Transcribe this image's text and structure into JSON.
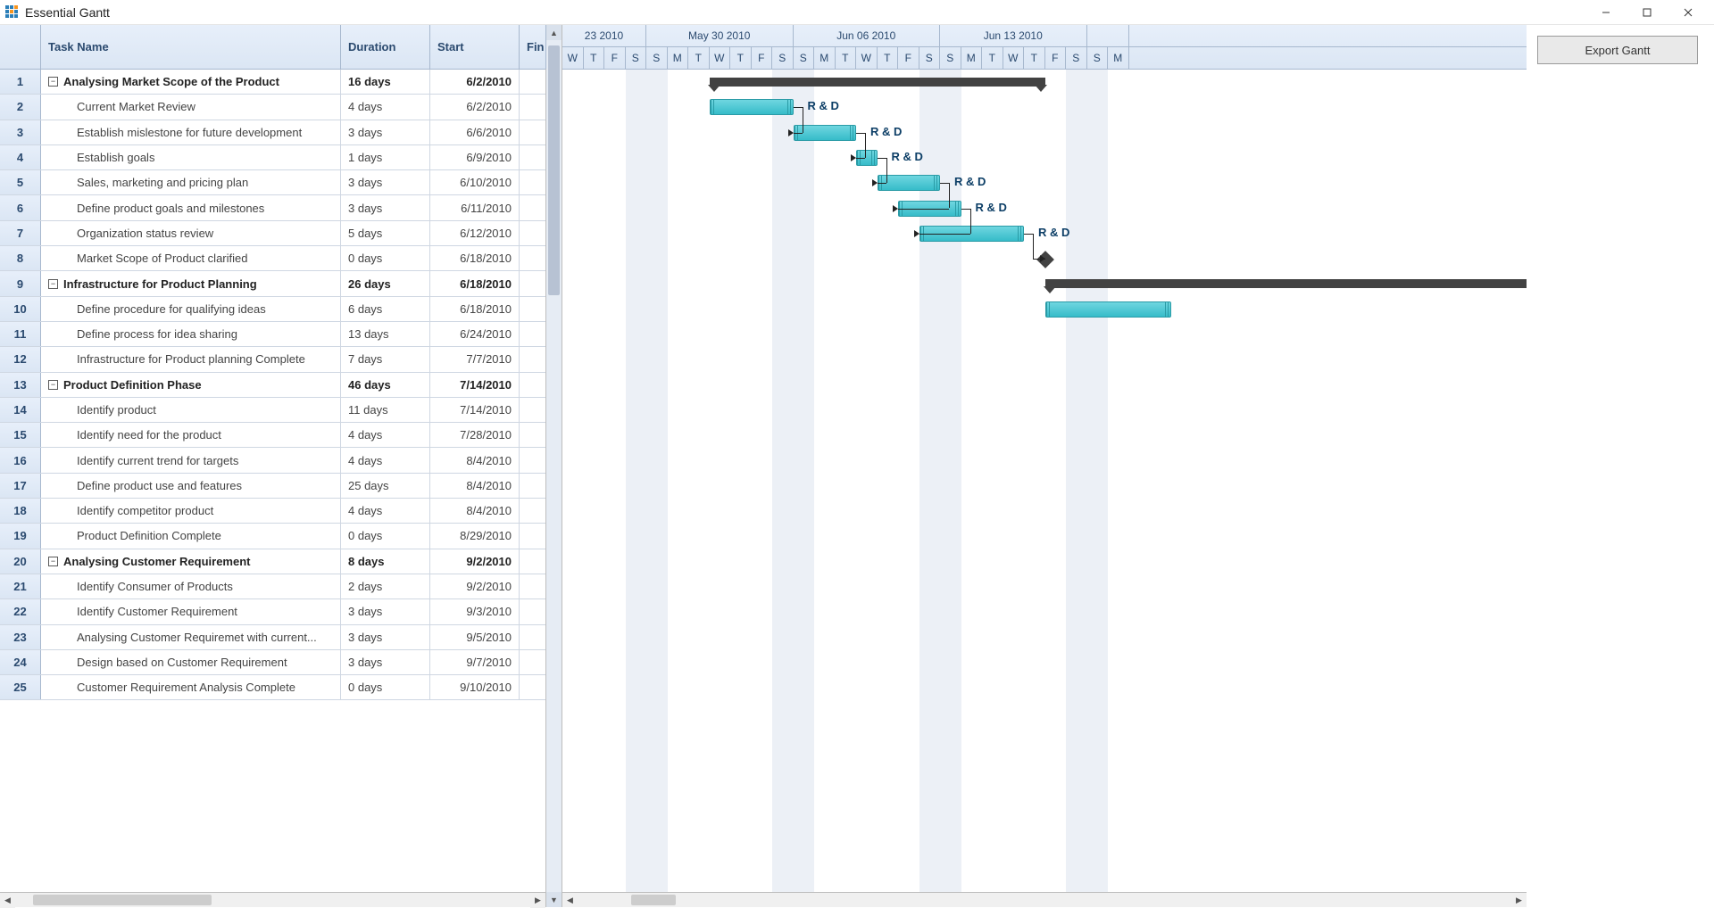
{
  "app": {
    "title": "Essential Gantt"
  },
  "columns": {
    "task": "Task Name",
    "duration": "Duration",
    "start": "Start",
    "finish": "Fin"
  },
  "export_label": "Export Gantt",
  "timescale": {
    "weeks": [
      {
        "label": "23 2010",
        "days": 4
      },
      {
        "label": "May 30 2010",
        "days": 7
      },
      {
        "label": "Jun 06 2010",
        "days": 7
      },
      {
        "label": "Jun 13 2010",
        "days": 7
      },
      {
        "label": "",
        "days": 2
      }
    ],
    "days": [
      "W",
      "T",
      "F",
      "S",
      "S",
      "M",
      "T",
      "W",
      "T",
      "F",
      "S",
      "S",
      "M",
      "T",
      "W",
      "T",
      "F",
      "S",
      "S",
      "M",
      "T",
      "W",
      "T",
      "F",
      "S",
      "S",
      "M"
    ]
  },
  "tasks": [
    {
      "num": 1,
      "type": "summary",
      "name": "Analysing Market Scope of the Product",
      "duration": "16 days",
      "start": "6/2/2010"
    },
    {
      "num": 2,
      "type": "task",
      "name": "Current Market Review",
      "duration": "4 days",
      "start": "6/2/2010",
      "res": "R & D"
    },
    {
      "num": 3,
      "type": "task",
      "name": "Establish mislestone for future development",
      "duration": "3 days",
      "start": "6/6/2010",
      "res": "R & D"
    },
    {
      "num": 4,
      "type": "task",
      "name": "Establish goals",
      "duration": "1 days",
      "start": "6/9/2010",
      "res": "R & D"
    },
    {
      "num": 5,
      "type": "task",
      "name": "Sales, marketing and pricing plan",
      "duration": "3 days",
      "start": "6/10/2010",
      "res": "R & D"
    },
    {
      "num": 6,
      "type": "task",
      "name": "Define product goals and milestones",
      "duration": "3 days",
      "start": "6/11/2010",
      "res": "R & D"
    },
    {
      "num": 7,
      "type": "task",
      "name": "Organization status review",
      "duration": "5 days",
      "start": "6/12/2010",
      "res": "R & D"
    },
    {
      "num": 8,
      "type": "task",
      "name": "Market Scope of Product clarified",
      "duration": "0 days",
      "start": "6/18/2010"
    },
    {
      "num": 9,
      "type": "summary",
      "name": "Infrastructure for Product Planning",
      "duration": "26 days",
      "start": "6/18/2010"
    },
    {
      "num": 10,
      "type": "task",
      "name": "Define procedure for qualifying ideas",
      "duration": "6 days",
      "start": "6/18/2010"
    },
    {
      "num": 11,
      "type": "task",
      "name": "Define process for idea sharing",
      "duration": "13 days",
      "start": "6/24/2010"
    },
    {
      "num": 12,
      "type": "task",
      "name": "Infrastructure for Product planning Complete",
      "duration": "7 days",
      "start": "7/7/2010"
    },
    {
      "num": 13,
      "type": "summary",
      "name": "Product Definition Phase",
      "duration": "46 days",
      "start": "7/14/2010"
    },
    {
      "num": 14,
      "type": "task",
      "name": "Identify product",
      "duration": "11 days",
      "start": "7/14/2010"
    },
    {
      "num": 15,
      "type": "task",
      "name": "Identify need for the product",
      "duration": "4 days",
      "start": "7/28/2010"
    },
    {
      "num": 16,
      "type": "task",
      "name": "Identify current trend for targets",
      "duration": "4 days",
      "start": "8/4/2010"
    },
    {
      "num": 17,
      "type": "task",
      "name": "Define product use and features",
      "duration": "25 days",
      "start": "8/4/2010"
    },
    {
      "num": 18,
      "type": "task",
      "name": "Identify competitor product",
      "duration": "4 days",
      "start": "8/4/2010"
    },
    {
      "num": 19,
      "type": "task",
      "name": "Product Definition Complete",
      "duration": "0 days",
      "start": "8/29/2010"
    },
    {
      "num": 20,
      "type": "summary",
      "name": "Analysing Customer Requirement",
      "duration": "8 days",
      "start": "9/2/2010"
    },
    {
      "num": 21,
      "type": "task",
      "name": "Identify Consumer of Products",
      "duration": "2 days",
      "start": "9/2/2010"
    },
    {
      "num": 22,
      "type": "task",
      "name": "Identify Customer Requirement",
      "duration": "3 days",
      "start": "9/3/2010"
    },
    {
      "num": 23,
      "type": "task",
      "name": "Analysing Customer Requiremet with current...",
      "duration": "3 days",
      "start": "9/5/2010"
    },
    {
      "num": 24,
      "type": "task",
      "name": "Design based on Customer Requirement",
      "duration": "3 days",
      "start": "9/7/2010"
    },
    {
      "num": 25,
      "type": "task",
      "name": "Customer Requirement Analysis Complete",
      "duration": "0 days",
      "start": "9/10/2010"
    }
  ],
  "chart_data": {
    "type": "gantt",
    "day_width": 23.5,
    "origin": "2010-05-26",
    "weekend_start_columns": [
      3,
      10,
      17,
      24
    ],
    "bars": [
      {
        "row": 0,
        "kind": "summary",
        "left_col": 7,
        "width_cols": 16
      },
      {
        "row": 1,
        "kind": "task",
        "left_col": 7,
        "width_cols": 4,
        "label": "R & D"
      },
      {
        "row": 2,
        "kind": "task",
        "left_col": 11,
        "width_cols": 3,
        "label": "R & D"
      },
      {
        "row": 3,
        "kind": "task",
        "left_col": 14,
        "width_cols": 1,
        "label": "R & D"
      },
      {
        "row": 4,
        "kind": "task",
        "left_col": 15,
        "width_cols": 3,
        "label": "R & D"
      },
      {
        "row": 5,
        "kind": "task",
        "left_col": 16,
        "width_cols": 3,
        "label": "R & D"
      },
      {
        "row": 6,
        "kind": "task",
        "left_col": 17,
        "width_cols": 5,
        "label": "R & D"
      },
      {
        "row": 7,
        "kind": "milestone",
        "left_col": 23
      },
      {
        "row": 8,
        "kind": "summary",
        "left_col": 23,
        "width_cols": 30
      },
      {
        "row": 9,
        "kind": "task",
        "left_col": 23,
        "width_cols": 6
      }
    ],
    "dependencies": [
      {
        "from_row": 1,
        "from_col": 11,
        "to_row": 2,
        "to_col": 11
      },
      {
        "from_row": 2,
        "from_col": 14,
        "to_row": 3,
        "to_col": 14
      },
      {
        "from_row": 3,
        "from_col": 15,
        "to_row": 4,
        "to_col": 15
      },
      {
        "from_row": 4,
        "from_col": 18,
        "to_row": 5,
        "to_col": 16,
        "back": true
      },
      {
        "from_row": 5,
        "from_col": 19,
        "to_row": 6,
        "to_col": 17,
        "back": true
      },
      {
        "from_row": 6,
        "from_col": 22,
        "to_row": 7,
        "to_col": 23
      }
    ]
  }
}
